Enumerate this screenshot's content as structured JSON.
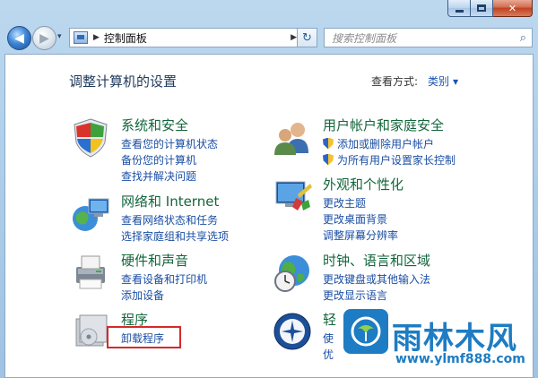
{
  "window": {
    "caption": {
      "minimize": "",
      "maximize": "",
      "close": "✕"
    }
  },
  "nav": {
    "back_glyph": "◀",
    "forward_glyph": "▶",
    "history_glyph": "▾",
    "breadcrumb": "控制面板",
    "crumb_sep": "▶",
    "crumb_sep2": "▶",
    "address_dropdown": "▾",
    "refresh_glyph": "↻",
    "search_placeholder": "搜索控制面板",
    "search_glyph": "⌕"
  },
  "header": {
    "title": "调整计算机的设置",
    "view_by_label": "查看方式:",
    "view_by_value": "类别"
  },
  "categories": {
    "system": {
      "title": "系统和安全",
      "links": [
        "查看您的计算机状态",
        "备份您的计算机",
        "查找并解决问题"
      ]
    },
    "network": {
      "title": "网络和 Internet",
      "links": [
        "查看网络状态和任务",
        "选择家庭组和共享选项"
      ]
    },
    "hardware": {
      "title": "硬件和声音",
      "links": [
        "查看设备和打印机",
        "添加设备"
      ]
    },
    "programs": {
      "title": "程序",
      "links": [
        "卸载程序"
      ]
    },
    "users": {
      "title": "用户帐户和家庭安全",
      "links": [
        "添加或删除用户帐户",
        "为所有用户设置家长控制"
      ]
    },
    "appearance": {
      "title": "外观和个性化",
      "links": [
        "更改主题",
        "更改桌面背景",
        "调整屏幕分辨率"
      ]
    },
    "clock": {
      "title": "时钟、语言和区域",
      "links": [
        "更改键盘或其他输入法",
        "更改显示语言"
      ]
    },
    "ease": {
      "title": "轻",
      "links": [
        "使",
        "优"
      ]
    }
  },
  "watermark": {
    "brand": "雨林木风",
    "url": "www.ylmf888.com"
  }
}
